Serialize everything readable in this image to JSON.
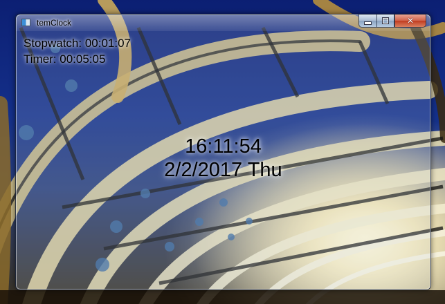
{
  "window": {
    "title": "temClock",
    "icon": "app-icon",
    "controls": {
      "minimize_icon": "minimize-icon",
      "maximize_icon": "maximize-icon",
      "close_glyph": "✕"
    }
  },
  "clock": {
    "stopwatch": "Stopwatch: 00:01:07",
    "timer": "Timer: 00:05:05",
    "time": "16:11:54",
    "date": "2/2/2017 Thu"
  },
  "colors": {
    "text": "#000000",
    "close_button": "#c13b20",
    "wallpaper_sky": "#14308a"
  }
}
